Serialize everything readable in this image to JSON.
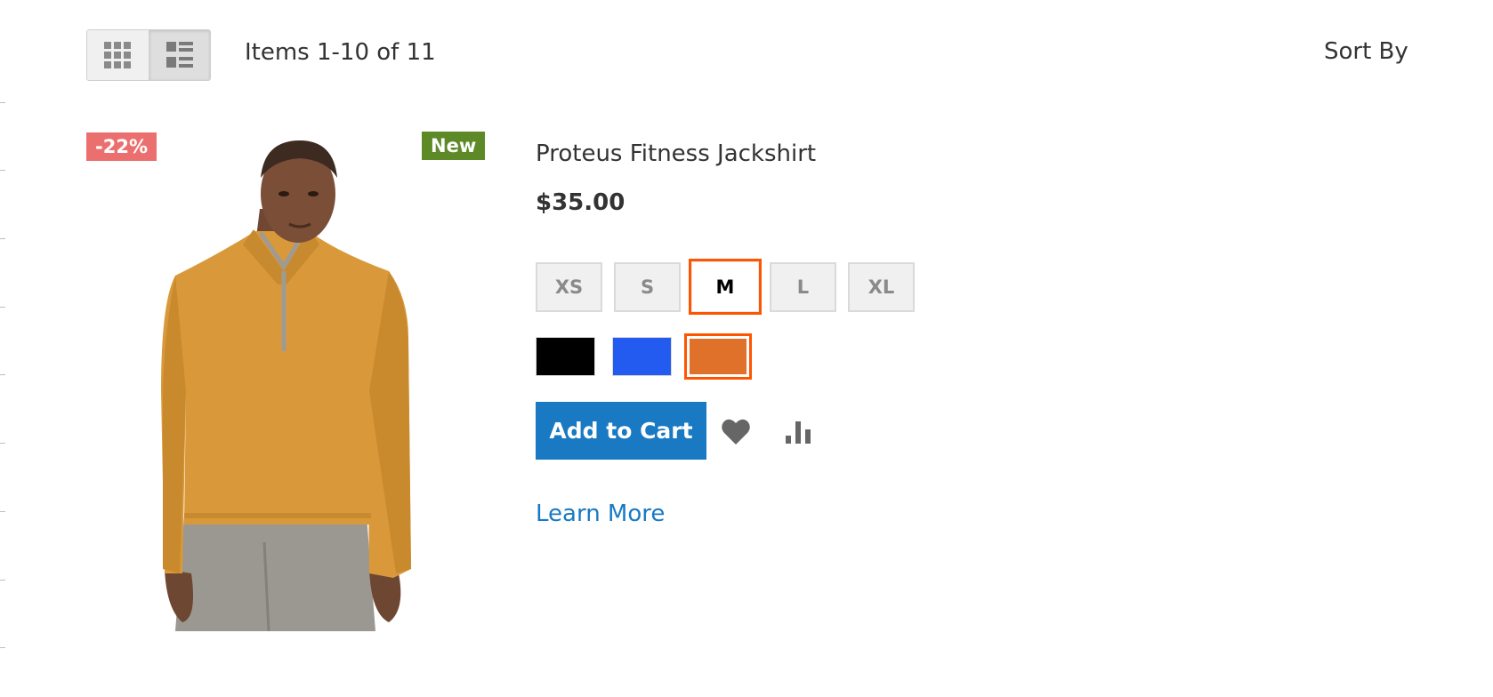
{
  "toolbar": {
    "modes": [
      {
        "name": "Grid",
        "icon": "grid-icon",
        "active": false
      },
      {
        "name": "List",
        "icon": "list-icon",
        "active": true
      }
    ],
    "amount_text": "Items 1-10 of 11",
    "sorter_label": "Sort By"
  },
  "product": {
    "sale_badge": "-22%",
    "new_badge": "New",
    "name": "Proteus Fitness Jackshirt",
    "price": "$35.00",
    "sizes": [
      {
        "label": "XS",
        "selected": false
      },
      {
        "label": "S",
        "selected": false
      },
      {
        "label": "M",
        "selected": true
      },
      {
        "label": "L",
        "selected": false
      },
      {
        "label": "XL",
        "selected": false
      }
    ],
    "colors": [
      {
        "name": "Black",
        "hex": "#000000",
        "selected": false
      },
      {
        "name": "Blue",
        "hex": "#235af0",
        "selected": false
      },
      {
        "name": "Orange",
        "hex": "#e0712b",
        "selected": true
      }
    ],
    "add_to_cart_label": "Add to Cart",
    "wishlist_icon": "heart-icon",
    "compare_icon": "bar-chart-icon",
    "learn_more_label": "Learn More"
  },
  "colors": {
    "accent": "#1979c3",
    "selected_outline": "#ff5501",
    "sale_badge": "#ec6f6f",
    "new_badge": "#5d8a27"
  }
}
